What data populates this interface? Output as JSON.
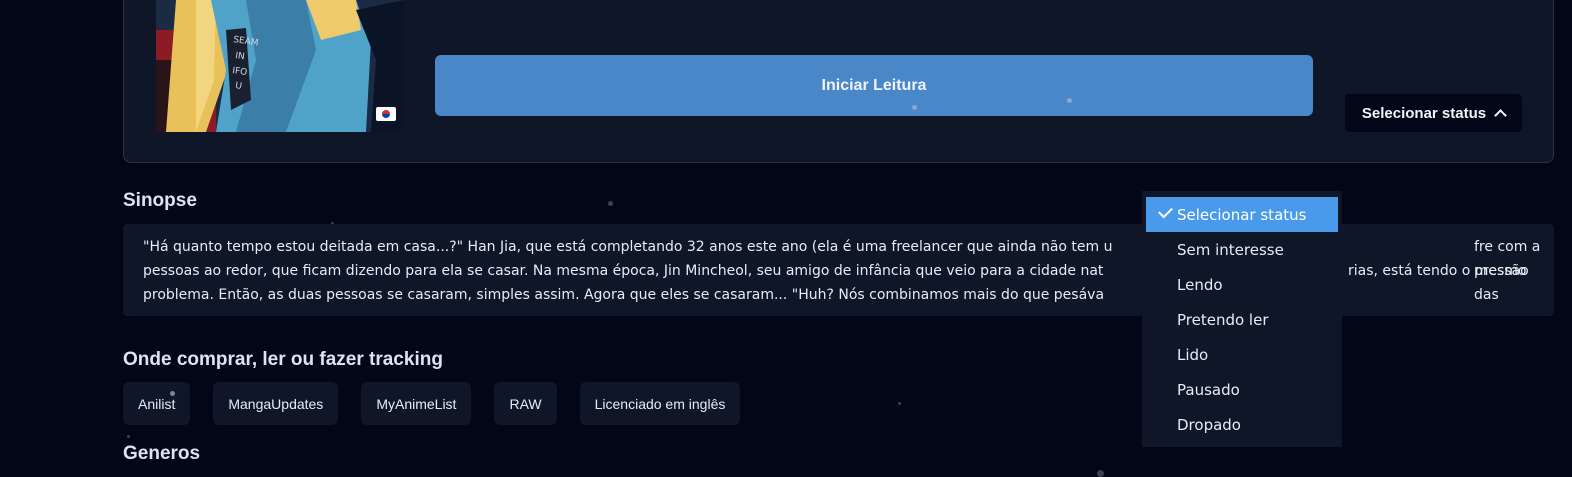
{
  "header": {
    "read_button_label": "Iniciar Leitura",
    "status_button_label": "Selecionar status"
  },
  "synopsis": {
    "title": "Sinopse",
    "lines": [
      "\"Há quanto tempo estou deitada em casa...?\" Han Jia, que está completando 32 anos este ano (ela é uma freelancer que ainda não tem u",
      "pessoas ao redor, que ficam dizendo para ela se casar. Na mesma época, Jin Mincheol, seu amigo de infância que veio para a cidade nat",
      "problema. Então, as duas pessoas se casaram, simples assim. Agora que eles se casaram... \"Huh? Nós combinamos mais do que pesáva"
    ],
    "right_fragments": [
      "fre com a pressão das",
      "rias, está tendo o mesmo"
    ]
  },
  "where_to_buy": {
    "title": "Onde comprar, ler ou fazer tracking",
    "links": [
      "Anilist",
      "MangaUpdates",
      "MyAnimeList",
      "RAW",
      "Licenciado em inglês"
    ]
  },
  "genres": {
    "title": "Generos"
  },
  "status_dropdown": {
    "selected": "Selecionar status",
    "options": [
      "Selecionar status",
      "Sem interesse",
      "Lendo",
      "Pretendo ler",
      "Lido",
      "Pausado",
      "Dropado"
    ]
  },
  "colors": {
    "background": "#030617",
    "card": "#0f1628",
    "primary_button": "#4a87c8",
    "selected_option": "#4a9aeb"
  },
  "icons": {
    "selected_option": "check-icon",
    "status_button": "chevron-up-icon",
    "origin_flag": "south-korea-flag-icon"
  }
}
